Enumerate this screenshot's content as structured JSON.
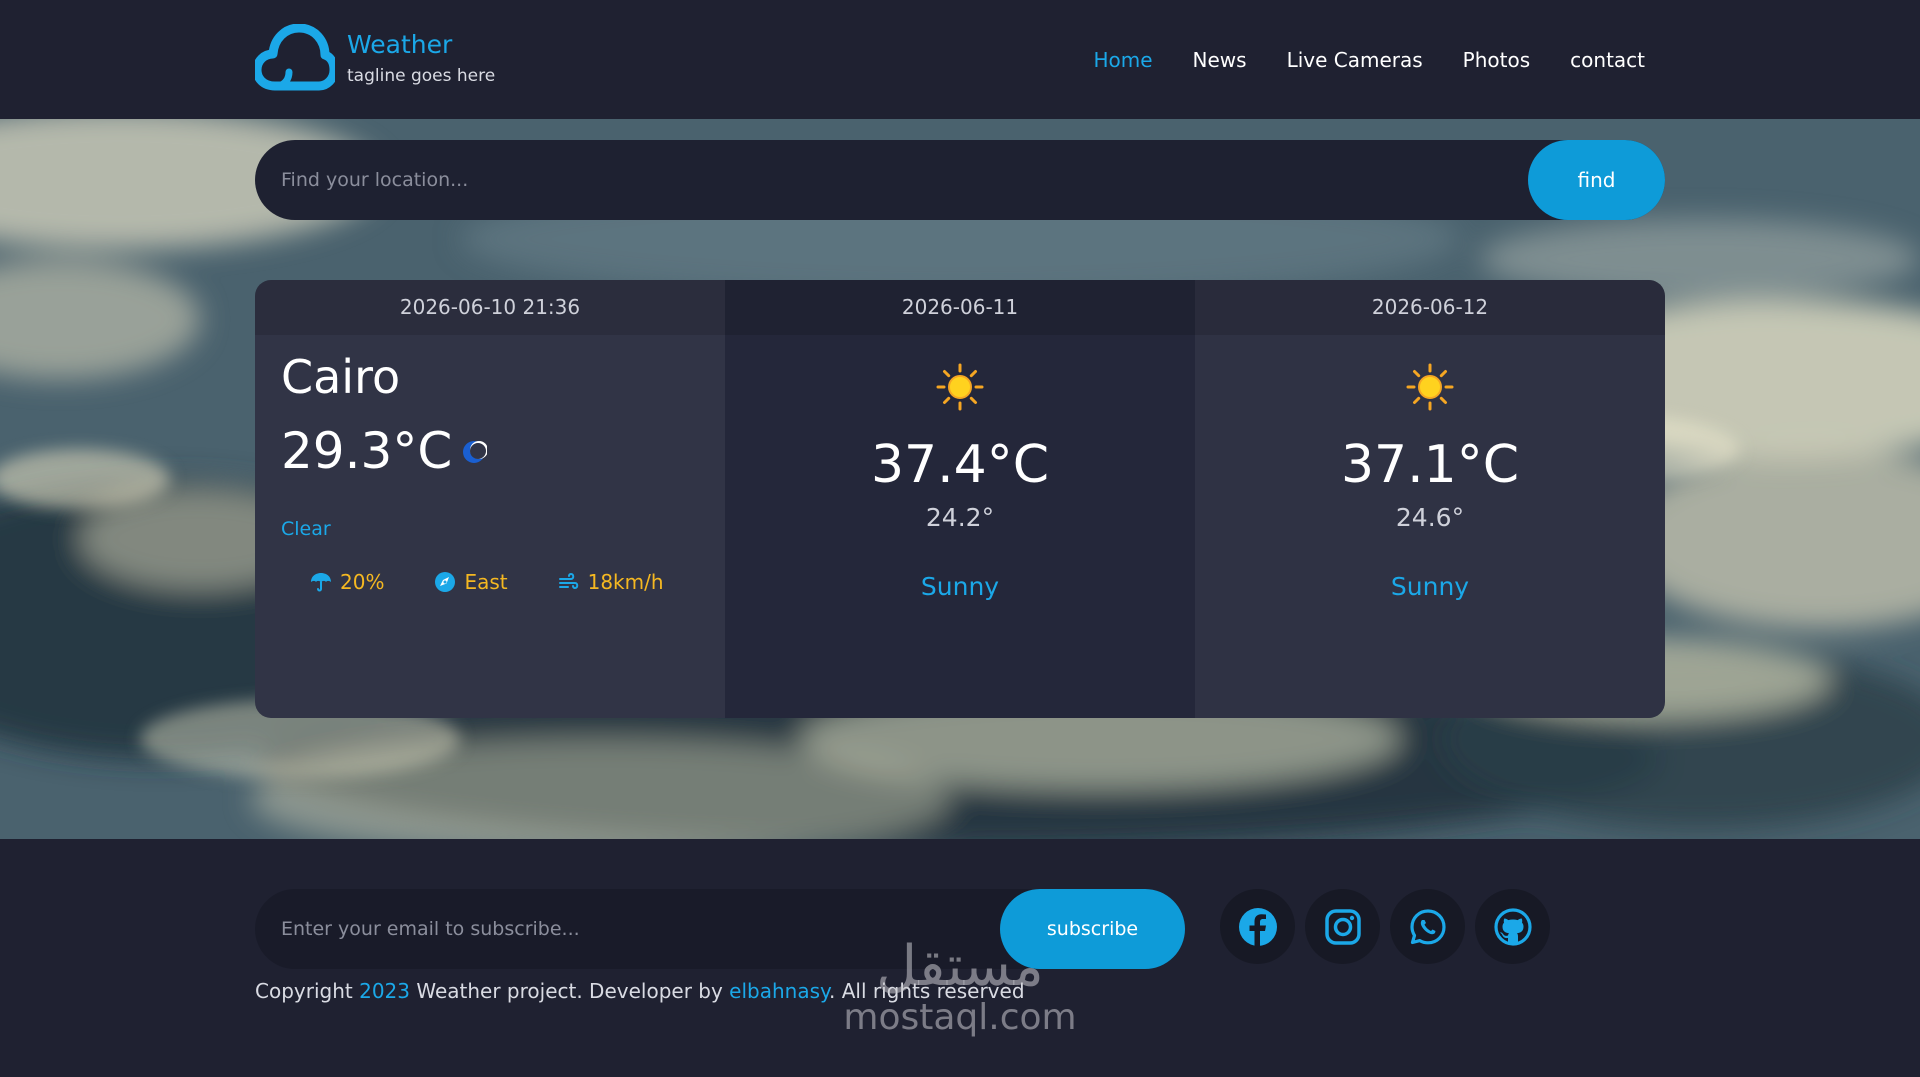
{
  "header": {
    "brand_title": "Weather",
    "brand_tagline": "tagline goes here",
    "logo_icon": "cloud-icon",
    "nav": [
      {
        "label": "Home",
        "active": true
      },
      {
        "label": "News",
        "active": false
      },
      {
        "label": "Live Cameras",
        "active": false
      },
      {
        "label": "Photos",
        "active": false
      },
      {
        "label": "contact",
        "active": false
      }
    ]
  },
  "search": {
    "placeholder": "Find your location...",
    "button_label": "find"
  },
  "forecast": {
    "today": {
      "datetime": "2026-06-10 21:36",
      "city": "Cairo",
      "temperature": "29.3°C",
      "icon": "moon-icon",
      "condition": "Clear",
      "humidity": "20%",
      "wind_direction": "East",
      "wind_speed": "18km/h"
    },
    "days": [
      {
        "date": "2026-06-11",
        "icon": "sun-icon",
        "max": "37.4°C",
        "min": "24.2°",
        "condition": "Sunny"
      },
      {
        "date": "2026-06-12",
        "icon": "sun-icon",
        "max": "37.1°C",
        "min": "24.6°",
        "condition": "Sunny"
      }
    ]
  },
  "footer": {
    "email_placeholder": "Enter your email to subscribe...",
    "subscribe_label": "subscribe",
    "socials": [
      "facebook-icon",
      "instagram-icon",
      "whatsapp-icon",
      "github-icon"
    ],
    "copyright_prefix": "Copyright ",
    "copyright_year": "2023",
    "copyright_middle": " Weather project. Developer by ",
    "copyright_author": "elbahnasy",
    "copyright_suffix": ". All rights reserved"
  },
  "watermark": {
    "arabic": "مستقل",
    "latin": "mostaql.com"
  },
  "colors": {
    "accent": "#1ba8e8",
    "button": "#0e9bd8",
    "stat": "#f5b821",
    "background": "#1f2131"
  }
}
